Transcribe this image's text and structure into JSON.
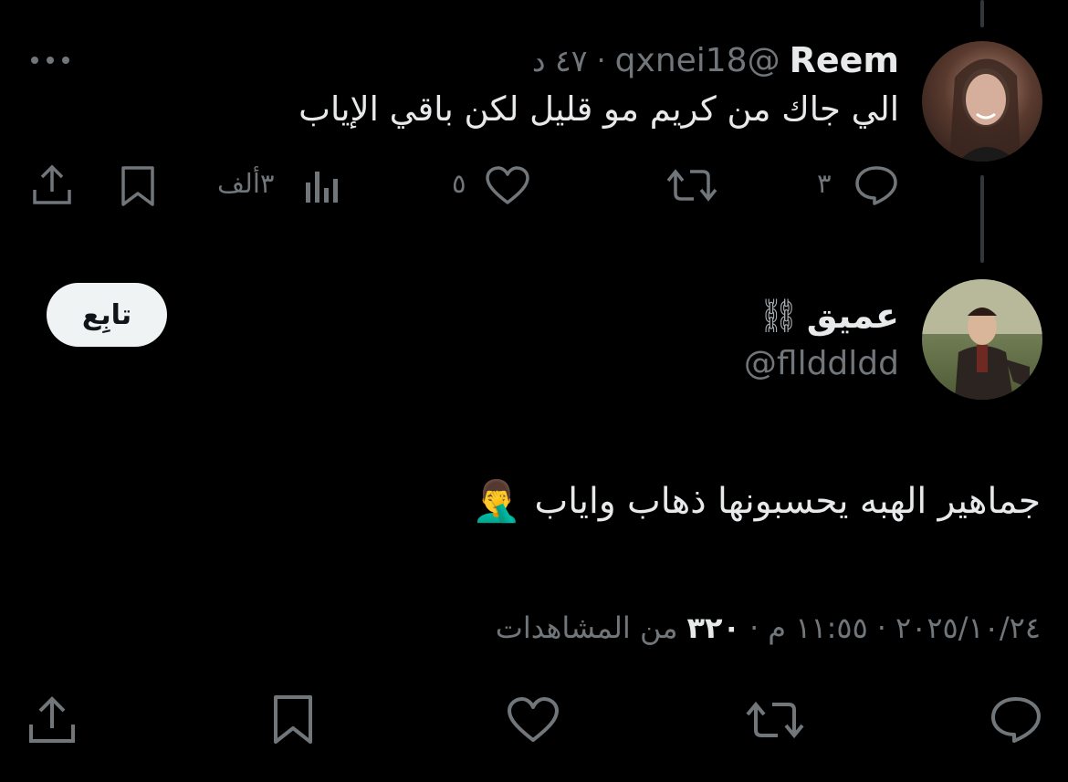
{
  "reply_tweet": {
    "author_name": "Reem",
    "author_handle": "@qxnei18",
    "separator": "·",
    "time_ago": "٤٧ د",
    "text": "الي جاك من كريم مو قليل لكن باقي الإياب",
    "replies": "٣",
    "likes": "٥",
    "views": "٣ألف"
  },
  "main_tweet": {
    "author_name": "عميق",
    "author_badge_emoji": "⛓",
    "author_handle": "@fllddldd",
    "follow_label": "تابِع",
    "text": "جماهير الهبه يحسبونها ذهاب واياب",
    "text_emoji": "🤦‍♂️",
    "date": "٢٠٢٥/١٠/٢٤",
    "time": "١١:٥٥ م",
    "views_count": "٣٢٠",
    "views_label": "من المشاهدات",
    "separator": "·"
  },
  "colors": {
    "background": "#000000",
    "text": "#e7e9ea",
    "muted": "#71767b",
    "thread_line": "#333639",
    "follow_bg": "#eff3f4"
  }
}
